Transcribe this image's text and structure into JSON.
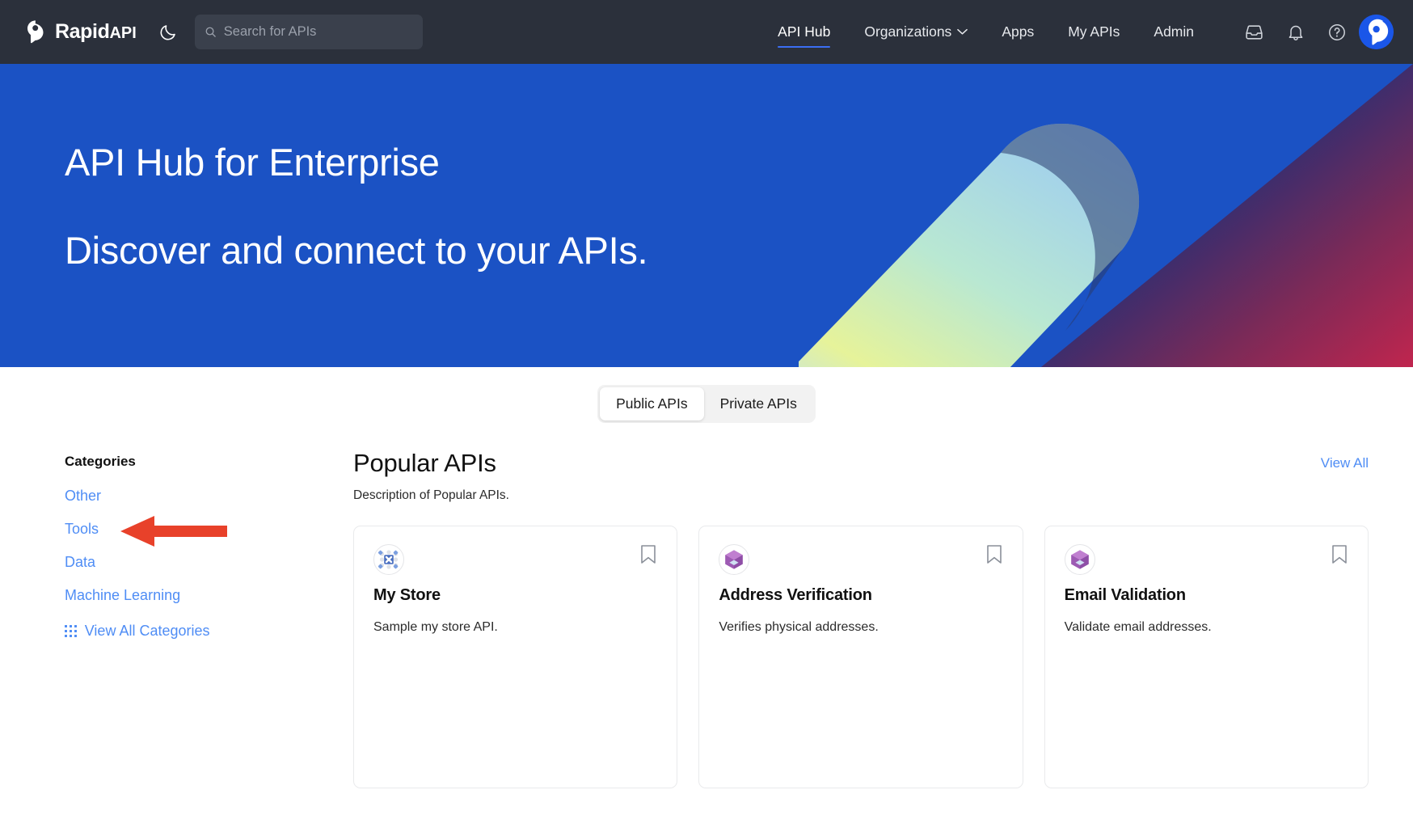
{
  "topnav": {
    "brand_name": "Rapid",
    "brand_suffix": "API",
    "theme_toggle_icon": "moon-icon",
    "search": {
      "placeholder": "Search for APIs",
      "value": "",
      "icon": "search-icon"
    },
    "links": [
      {
        "label": "API Hub",
        "active": true,
        "has_caret": false
      },
      {
        "label": "Organizations",
        "active": false,
        "has_caret": true
      },
      {
        "label": "Apps",
        "active": false,
        "has_caret": false
      },
      {
        "label": "My APIs",
        "active": false,
        "has_caret": false
      },
      {
        "label": "Admin",
        "active": false,
        "has_caret": false
      }
    ],
    "icons": [
      {
        "name": "inbox-icon"
      },
      {
        "name": "bell-icon"
      },
      {
        "name": "help-circle-icon"
      }
    ],
    "avatar": {
      "name": "user-avatar"
    },
    "colors": {
      "background": "#2b303b",
      "search_background": "#3a404c",
      "active_underline": "#3b6ef3",
      "avatar_background": "#1a56e8"
    }
  },
  "hero": {
    "title": "API Hub for Enterprise",
    "subtitle": "Discover and connect to your APIs.",
    "background": "#1b52c4"
  },
  "tabs": [
    {
      "label": "Public APIs",
      "active": true
    },
    {
      "label": "Private APIs",
      "active": false
    }
  ],
  "sidebar": {
    "title": "Categories",
    "items": [
      {
        "label": "Other"
      },
      {
        "label": "Tools"
      },
      {
        "label": "Data"
      },
      {
        "label": "Machine Learning"
      }
    ],
    "view_all": {
      "label": "View All Categories",
      "icon": "grid-dots-icon"
    },
    "link_color": "#4f8df5"
  },
  "annotation": {
    "type": "arrow",
    "direction": "left",
    "points_at": "Data",
    "color": "#e8412a"
  },
  "main": {
    "title": "Popular APIs",
    "description": "Description of Popular APIs.",
    "view_all_label": "View All",
    "cards": [
      {
        "name": "My Store",
        "description": "Sample my store API.",
        "icon": "broken-image-icon",
        "bookmark_icon": "bookmark-icon"
      },
      {
        "name": "Address Verification",
        "description": "Verifies physical addresses.",
        "icon": "purple-cube-icon",
        "bookmark_icon": "bookmark-icon"
      },
      {
        "name": "Email Validation",
        "description": "Validate email addresses.",
        "icon": "purple-cube-icon",
        "bookmark_icon": "bookmark-icon"
      }
    ]
  }
}
